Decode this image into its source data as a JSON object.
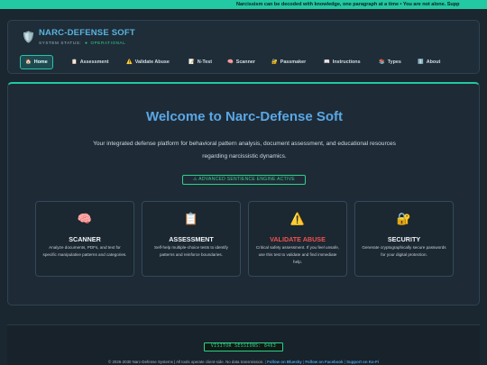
{
  "ticker": {
    "text": "Narcissism can be decoded with knowledge, one paragraph at a time  •  You are not alone. Supp"
  },
  "header": {
    "title": "NARC-DEFENSE SOFT",
    "status_label": "SYSTEM STATUS:",
    "status_value": "OPERATIONAL"
  },
  "nav": {
    "items": [
      {
        "label": "Home",
        "icon": "home-icon",
        "glyph": "🏠"
      },
      {
        "label": "Assessment",
        "icon": "clipboard-icon",
        "glyph": "📋"
      },
      {
        "label": "Validate Abuse",
        "icon": "warning-icon",
        "glyph": "⚠️"
      },
      {
        "label": "N-Test",
        "icon": "memo-icon",
        "glyph": "📝"
      },
      {
        "label": "Scanner",
        "icon": "brain-icon",
        "glyph": "🧠"
      },
      {
        "label": "Passmaker",
        "icon": "lock-key-icon",
        "glyph": "🔐"
      },
      {
        "label": "Instructions",
        "icon": "book-icon",
        "glyph": "📖"
      },
      {
        "label": "Types",
        "icon": "books-icon",
        "glyph": "📚"
      },
      {
        "label": "About",
        "icon": "info-icon",
        "glyph": "ℹ️"
      }
    ]
  },
  "main": {
    "welcome": "Welcome to Narc-Defense Soft",
    "intro": "Your integrated defense platform for behavioral pattern analysis, document assessment, and educational resources regarding narcissistic dynamics.",
    "engine_badge": "⚠ ADVANCED SENTIENCE ENGINE ACTIVE",
    "cards": [
      {
        "icon": "brain-icon",
        "glyph": "🧠",
        "title": "SCANNER",
        "desc": "Analyze documents, PDFs, and text for specific manipulative patterns and categories."
      },
      {
        "icon": "clipboard-icon",
        "glyph": "📋",
        "title": "ASSESSMENT",
        "desc": "Self-help multiple-choice tests to identify patterns and reinforce boundaries."
      },
      {
        "icon": "warning-icon",
        "glyph": "⚠️",
        "title": "VALIDATE ABUSE",
        "desc": "Critical safety assessment. If you feel unsafe, use this test to validate and find immediate help."
      },
      {
        "icon": "lock-key-icon",
        "glyph": "🔐",
        "title": "SECURITY",
        "desc": "Generate cryptographically secure passwords for your digital protection."
      }
    ]
  },
  "footer": {
    "visitor_counter": "VISITOR SESSIONS: 8463",
    "copyright": "© 2026-2030 Narc-Defense Systems | All tools operate client-side. No data transmission.",
    "links": [
      "Follow on Bluesky",
      "Follow on Facebook",
      "Support on Ko-Fi"
    ]
  },
  "colors": {
    "accent": "#22c9a3",
    "title_blue": "#5aa7e6",
    "status_green": "#2fd08a",
    "danger": "#ef5350"
  }
}
